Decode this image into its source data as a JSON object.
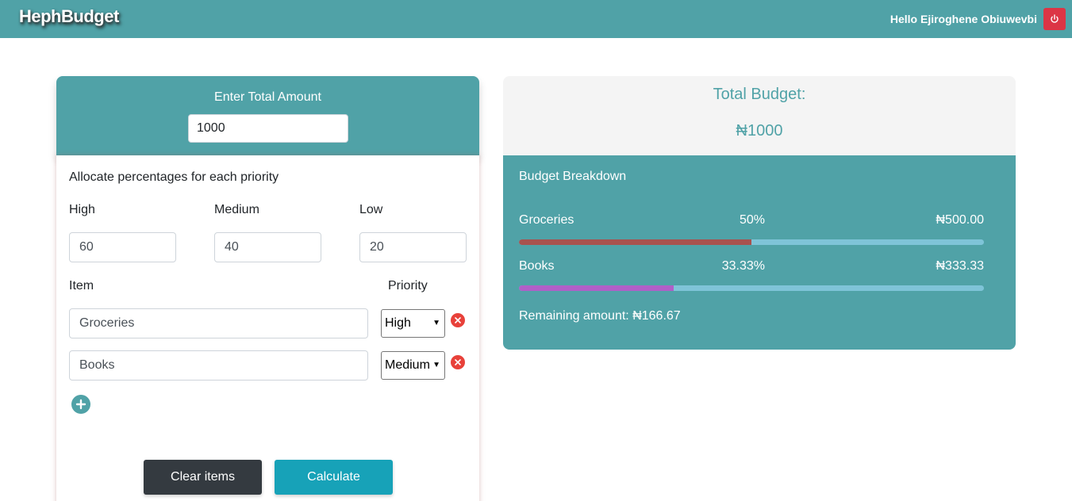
{
  "navbar": {
    "brand": "HephBudget",
    "greeting": "Hello Ejiroghene Obiuwevbi",
    "power_icon": "power-icon"
  },
  "left": {
    "total_label": "Enter Total Amount",
    "total_value": "1000",
    "allocate_title": "Allocate percentages for each priority",
    "priorities": [
      {
        "label": "High",
        "value": "60"
      },
      {
        "label": "Medium",
        "value": "40"
      },
      {
        "label": "Low",
        "value": "20"
      }
    ],
    "item_col": "Item",
    "priority_col": "Priority",
    "items": [
      {
        "name": "Groceries",
        "priority": "High"
      },
      {
        "name": "Books",
        "priority": "Medium"
      }
    ],
    "clear_label": "Clear items",
    "calculate_label": "Calculate"
  },
  "right": {
    "total_label": "Total Budget:",
    "total_amount": "₦1000",
    "breakdown_title": "Budget Breakdown",
    "rows": [
      {
        "name": "Groceries",
        "percent": "50%",
        "amount": "₦500.00",
        "fraction": 0.5,
        "color": "#a8524e"
      },
      {
        "name": "Books",
        "percent": "33.33%",
        "amount": "₦333.33",
        "fraction": 0.3333,
        "color": "#b05fc8"
      }
    ],
    "remaining": "Remaining amount: ₦166.67"
  },
  "colors": {
    "primary": "#50a2a7",
    "danger": "#dc3545",
    "dark": "#343a40",
    "info": "#17a2b8"
  }
}
